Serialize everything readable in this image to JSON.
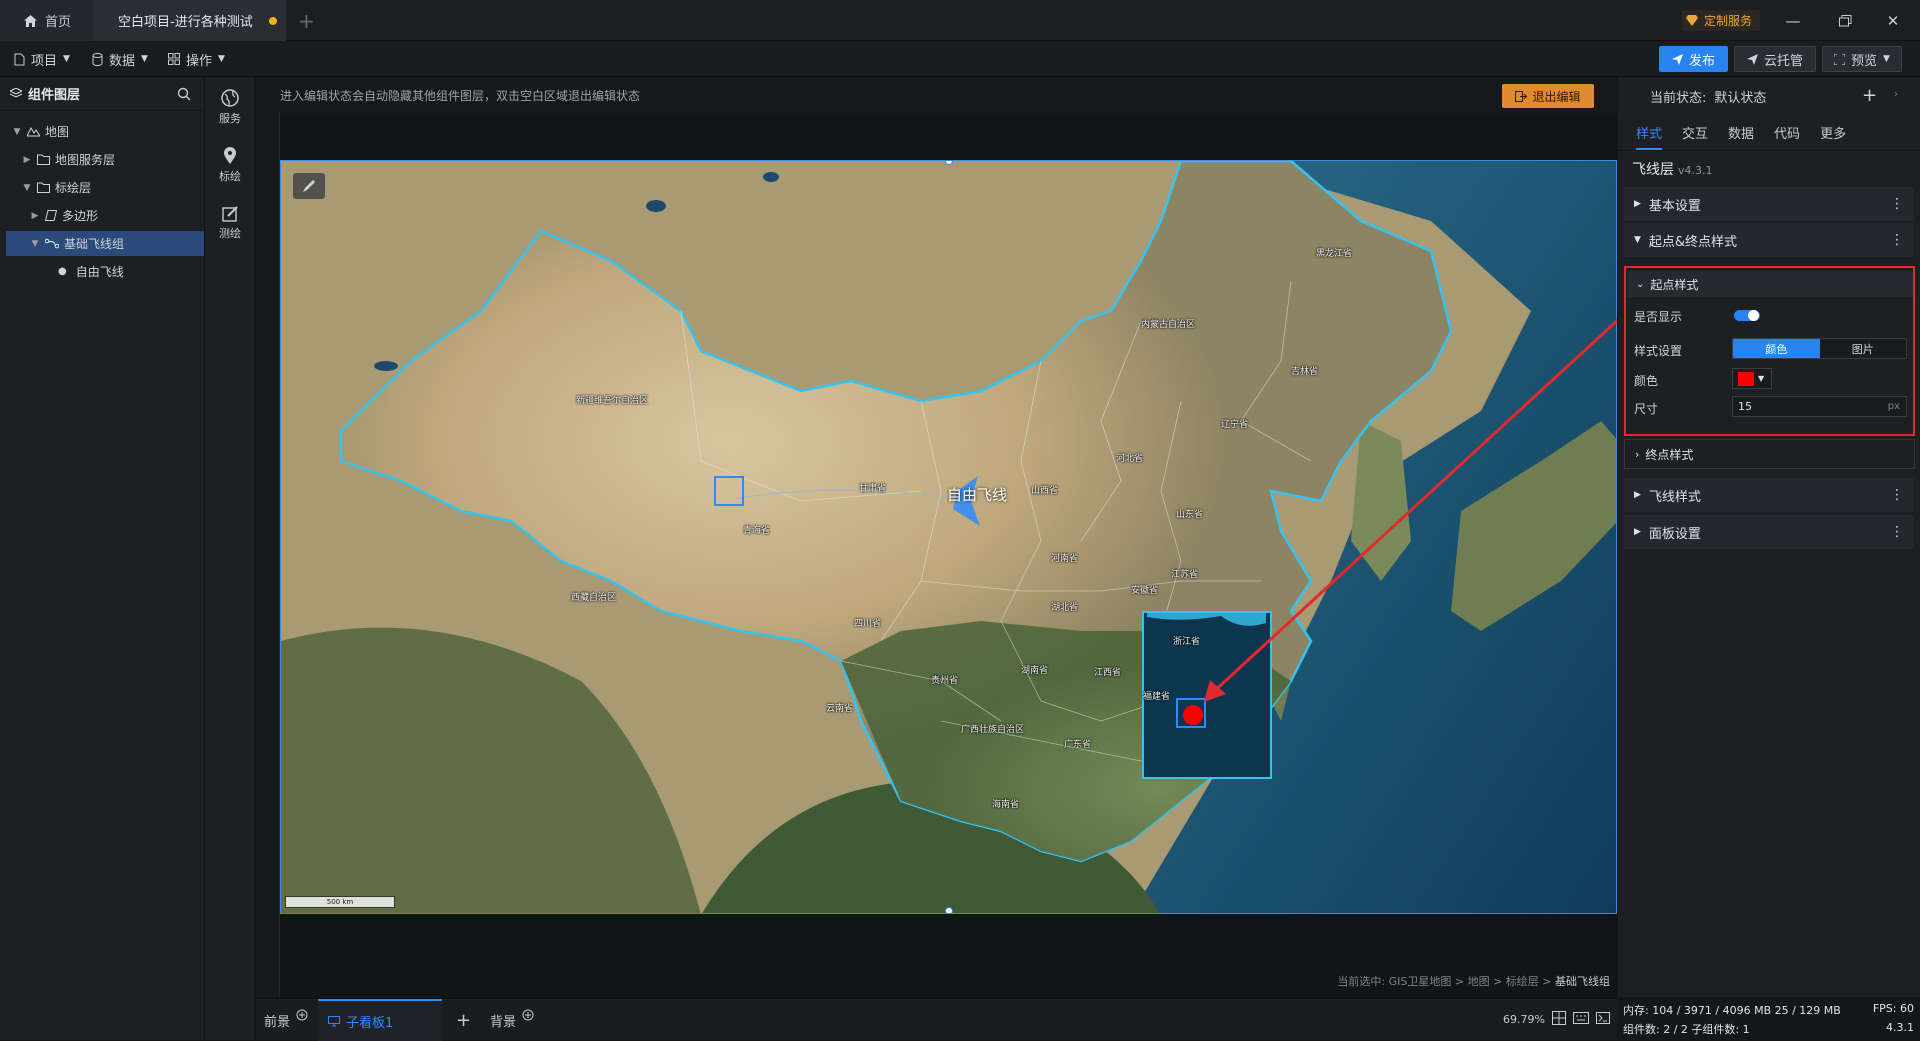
{
  "titlebar": {
    "home_tab": "首页",
    "project_tab": "空白项目-进行各种测试",
    "custom_service": "定制服务"
  },
  "menubar": {
    "project": "项目",
    "data": "数据",
    "operation": "操作",
    "publish": "发布",
    "cloud_host": "云托管",
    "preview": "预览"
  },
  "layers": {
    "title": "组件图层",
    "items": [
      "地图",
      "地图服务层",
      "标绘层",
      "多边形",
      "基础飞线组",
      "自由飞线"
    ]
  },
  "tools": [
    "服务",
    "标绘",
    "测绘"
  ],
  "canvas": {
    "hint": "进入编辑状态会自动隐藏其他组件图层，双击空白区域退出编辑状态",
    "exit_edit": "退出编辑",
    "breadcrumb_prefix": "当前选中: GIS卫星地图 > 地图 > 标绘层 >",
    "breadcrumb_current": "基础飞线组",
    "scale_label": "500 km",
    "flyline_label": "自由飞线"
  },
  "map_labels": {
    "heilongjiang": "黑龙江省",
    "neimenggu": "内蒙古自治区",
    "jilin": "吉林省",
    "liaoning": "辽宁省",
    "xinjiang": "新疆维吾尔自治区",
    "hebei": "河北省",
    "gansu": "甘肃省",
    "shanxi": "山西省",
    "shandong": "山东省",
    "qinghai": "青海省",
    "henan": "河南省",
    "jiangsu": "江苏省",
    "anhui": "安徽省",
    "xizang": "西藏自治区",
    "hubei": "湖北省",
    "sichuan": "四川省",
    "zhejiang": "浙江省",
    "guizhou": "贵州省",
    "hunan": "湖南省",
    "jiangxi": "江西省",
    "fujian": "福建省",
    "yunnan": "云南省",
    "guangxi": "广西壮族自治区",
    "guangdong": "广东省",
    "hainan": "海南省"
  },
  "bottombar": {
    "foreground": "前景",
    "sub_board": "子看板1",
    "background": "背景",
    "zoom": "69.79%"
  },
  "panel": {
    "state_label": "当前状态:",
    "state_value": "默认状态",
    "tabs": [
      "样式",
      "交互",
      "数据",
      "代码",
      "更多"
    ],
    "component_name": "飞线层",
    "component_version": "v4.3.1",
    "sections": {
      "basic": "基本设置",
      "start_end": "起点&终点样式",
      "start_style": "起点样式",
      "end_style": "终点样式",
      "fly_style": "飞线样式",
      "panel_settings": "面板设置"
    },
    "props": {
      "show": "是否显示",
      "style_setting": "样式设置",
      "style_color": "颜色",
      "style_image": "图片",
      "color": "颜色",
      "color_value": "#ff0000",
      "size": "尺寸",
      "size_value": "15",
      "size_unit": "px"
    }
  },
  "status": {
    "memory": "内存: 104 / 3971 / 4096 MB  25 / 129 MB",
    "fps": "FPS: 60",
    "components": "组件数: 2 / 2  子组件数: 1",
    "version": "4.3.1"
  }
}
